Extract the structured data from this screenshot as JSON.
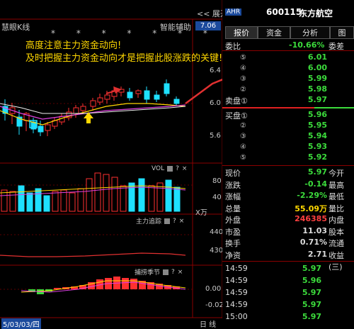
{
  "chart_header": {
    "left_label": "慧眼K线",
    "right_label": "智能辅助",
    "expand_label": "<< 展开",
    "price_tag": "7.06",
    "stars": "* * * * * * * * *"
  },
  "annotation": {
    "line1": "高度注意主力资金动向!",
    "line2": "及时把握主力资金动向才是把握此股涨跌的关键!"
  },
  "main_axis": {
    "labels": [
      "6.4",
      "6.0",
      "5.6"
    ]
  },
  "vol_panel": {
    "title": "VOL",
    "unit": "X万",
    "labels": [
      "80",
      "40"
    ]
  },
  "zhuli_panel": {
    "title": "主力追踪",
    "labels": [
      "440",
      "430"
    ]
  },
  "season_panel": {
    "title": "捕捞季节",
    "labels": [
      "0.00",
      "-0.02"
    ]
  },
  "bottom": {
    "date": "5/03/03/四",
    "day_label": "日 线"
  },
  "stock": {
    "badge": "AHR",
    "code": "600115",
    "name": "东方航空"
  },
  "tabs": [
    "报价",
    "资金",
    "分析",
    "图"
  ],
  "weibi": {
    "label": "委比",
    "ratio": "-10.66%",
    "diff_label": "委差"
  },
  "sell_label": "卖盘",
  "buy_label": "买盘",
  "sell_orders": [
    {
      "level": "⑤",
      "price": "6.01"
    },
    {
      "level": "④",
      "price": "6.00"
    },
    {
      "level": "③",
      "price": "5.99"
    },
    {
      "level": "②",
      "price": "5.98"
    },
    {
      "level": "①",
      "price": "5.97"
    }
  ],
  "buy_orders": [
    {
      "level": "①",
      "price": "5.96"
    },
    {
      "level": "②",
      "price": "5.95"
    },
    {
      "level": "③",
      "price": "5.94"
    },
    {
      "level": "④",
      "price": "5.93"
    },
    {
      "level": "⑤",
      "price": "5.92"
    }
  ],
  "stats": [
    {
      "l": "现价",
      "v": "5.97",
      "r": "今开",
      "color": "#3cdc3c"
    },
    {
      "l": "涨跌",
      "v": "-0.14",
      "r": "最高",
      "color": "#3cdc3c"
    },
    {
      "l": "涨幅",
      "v": "-2.29%",
      "r": "最低",
      "color": "#3cdc3c"
    },
    {
      "l": "总量",
      "v": "55.09万",
      "r": "量比",
      "color": "#ffd800"
    },
    {
      "l": "外盘",
      "v": "246385",
      "r": "内盘",
      "color": "#ff4040"
    },
    {
      "l": "市盈",
      "v": "11.03",
      "r": "股本",
      "color": "#ddd"
    },
    {
      "l": "换手",
      "v": "0.71%",
      "r": "流通",
      "color": "#ddd"
    },
    {
      "l": "净资",
      "v": "2.71",
      "r": "收益(三)",
      "color": "#ddd"
    }
  ],
  "ticks": [
    {
      "t": "14:59",
      "p": "5.97"
    },
    {
      "t": "14:59",
      "p": "5.96"
    },
    {
      "t": "14:59",
      "p": "5.97"
    },
    {
      "t": "14:59",
      "p": "5.97"
    },
    {
      "t": "15:00",
      "p": "5.97"
    }
  ],
  "colors": {
    "up": "#ff3030",
    "down": "#1ee0ff",
    "green": "#3cdc3c",
    "yellow": "#ffd800",
    "accent_red": "#e02020"
  }
}
